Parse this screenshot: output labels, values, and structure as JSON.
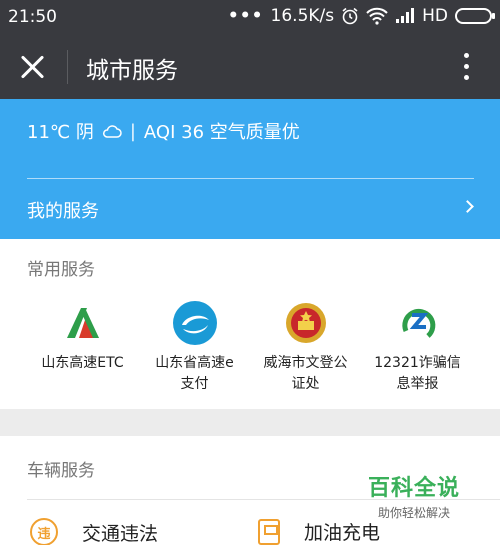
{
  "status_bar": {
    "time": "21:50",
    "dots": "•••",
    "net_speed": "16.5K/s",
    "network_type": "HD"
  },
  "title_bar": {
    "title": "城市服务"
  },
  "header": {
    "weather_temp": "11℃ 阴",
    "aqi": "AQI 36 空气质量优",
    "my_services": "我的服务"
  },
  "common_services": {
    "title": "常用服务",
    "items": [
      {
        "label_line1": "山东高速ETC",
        "label_line2": "",
        "icon": "etc-logo-icon"
      },
      {
        "label_line1": "山东省高速e",
        "label_line2": "支付",
        "icon": "e-pay-logo-icon"
      },
      {
        "label_line1": "威海市文登公",
        "label_line2": "证处",
        "icon": "national-emblem-icon"
      },
      {
        "label_line1": "12321诈骗信",
        "label_line2": "息举报",
        "icon": "12321-logo-icon"
      }
    ]
  },
  "vehicle_services": {
    "title": "车辆服务",
    "items": [
      {
        "label": "交通违法",
        "icon_char": "违"
      },
      {
        "label": "加油充电"
      }
    ]
  },
  "watermark": {
    "title": "百科全说",
    "subtitle": "助你轻松解决"
  },
  "colors": {
    "header_blue": "#3aa9f0",
    "bar_dark": "#393a3f",
    "accent_orange": "#f0a030",
    "watermark_green": "#3ab05a"
  }
}
